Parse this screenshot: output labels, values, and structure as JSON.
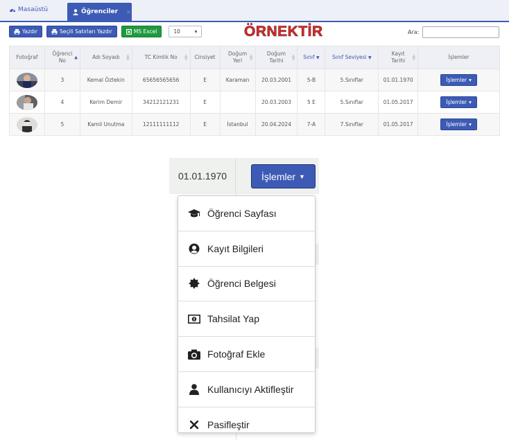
{
  "tabs": {
    "home_label": "Masaüstü",
    "active_label": "Öğrenciler",
    "close_glyph": "×"
  },
  "toolbar": {
    "print_label": "Yazdır",
    "print_selected_label": "Seçili Satırları Yazdır",
    "excel_label": "MS Excel",
    "page_length": "10",
    "watermark": "ÖRNEKTİR",
    "search_label": "Ara:",
    "search_value": ""
  },
  "table": {
    "headers": [
      "Fotoğraf",
      "Öğrenci No",
      "Adı Soyadı",
      "TC Kimlik No",
      "Cinsiyet",
      "Doğum Yeri",
      "Doğum Tarihi",
      "Sınıf",
      "Sınıf Seviyesi",
      "Kayıt Tarihi",
      "İşlemler"
    ],
    "rows": [
      {
        "no": "3",
        "name": "Kemal Öztekin",
        "tc": "65656565656",
        "gender": "E",
        "birthplace": "Karaman",
        "birthdate": "20.03.2001",
        "class": "5-B",
        "level": "5.Sınıflar",
        "reg_date": "01.01.1970",
        "action": "İşlemler"
      },
      {
        "no": "4",
        "name": "Kerim Demir",
        "tc": "34212121231",
        "gender": "E",
        "birthplace": "",
        "birthdate": "20.03.2003",
        "class": "5 E",
        "level": "5.Sınıflar",
        "reg_date": "01.05.2017",
        "action": "İşlemler"
      },
      {
        "no": "5",
        "name": "Kamil Unutma",
        "tc": "12111111112",
        "gender": "E",
        "birthplace": "İstanbul",
        "birthdate": "20.04.2024",
        "class": "7-A",
        "level": "7.Sınıflar",
        "reg_date": "01.05.2017",
        "action": "İşlemler"
      }
    ]
  },
  "zoom": {
    "reg_date": "01.01.1970",
    "button_label": "İşlemler",
    "menu": [
      {
        "label": "Öğrenci Sayfası",
        "icon": "graduation-cap-icon"
      },
      {
        "label": "Kayıt Bilgileri",
        "icon": "user-circle-icon"
      },
      {
        "label": "Öğrenci Belgesi",
        "icon": "certificate-icon"
      },
      {
        "label": "Tahsilat Yap",
        "icon": "money-icon"
      },
      {
        "label": "Fotoğraf Ekle",
        "icon": "camera-icon"
      },
      {
        "label": "Kullanıcıyı Aktifleştir",
        "icon": "user-icon"
      },
      {
        "label": "Pasifleştir",
        "icon": "times-icon"
      }
    ]
  },
  "colors": {
    "primary": "#3d5bb5",
    "excel_green": "#1e9a3e",
    "watermark_red": "#d62e2e"
  }
}
